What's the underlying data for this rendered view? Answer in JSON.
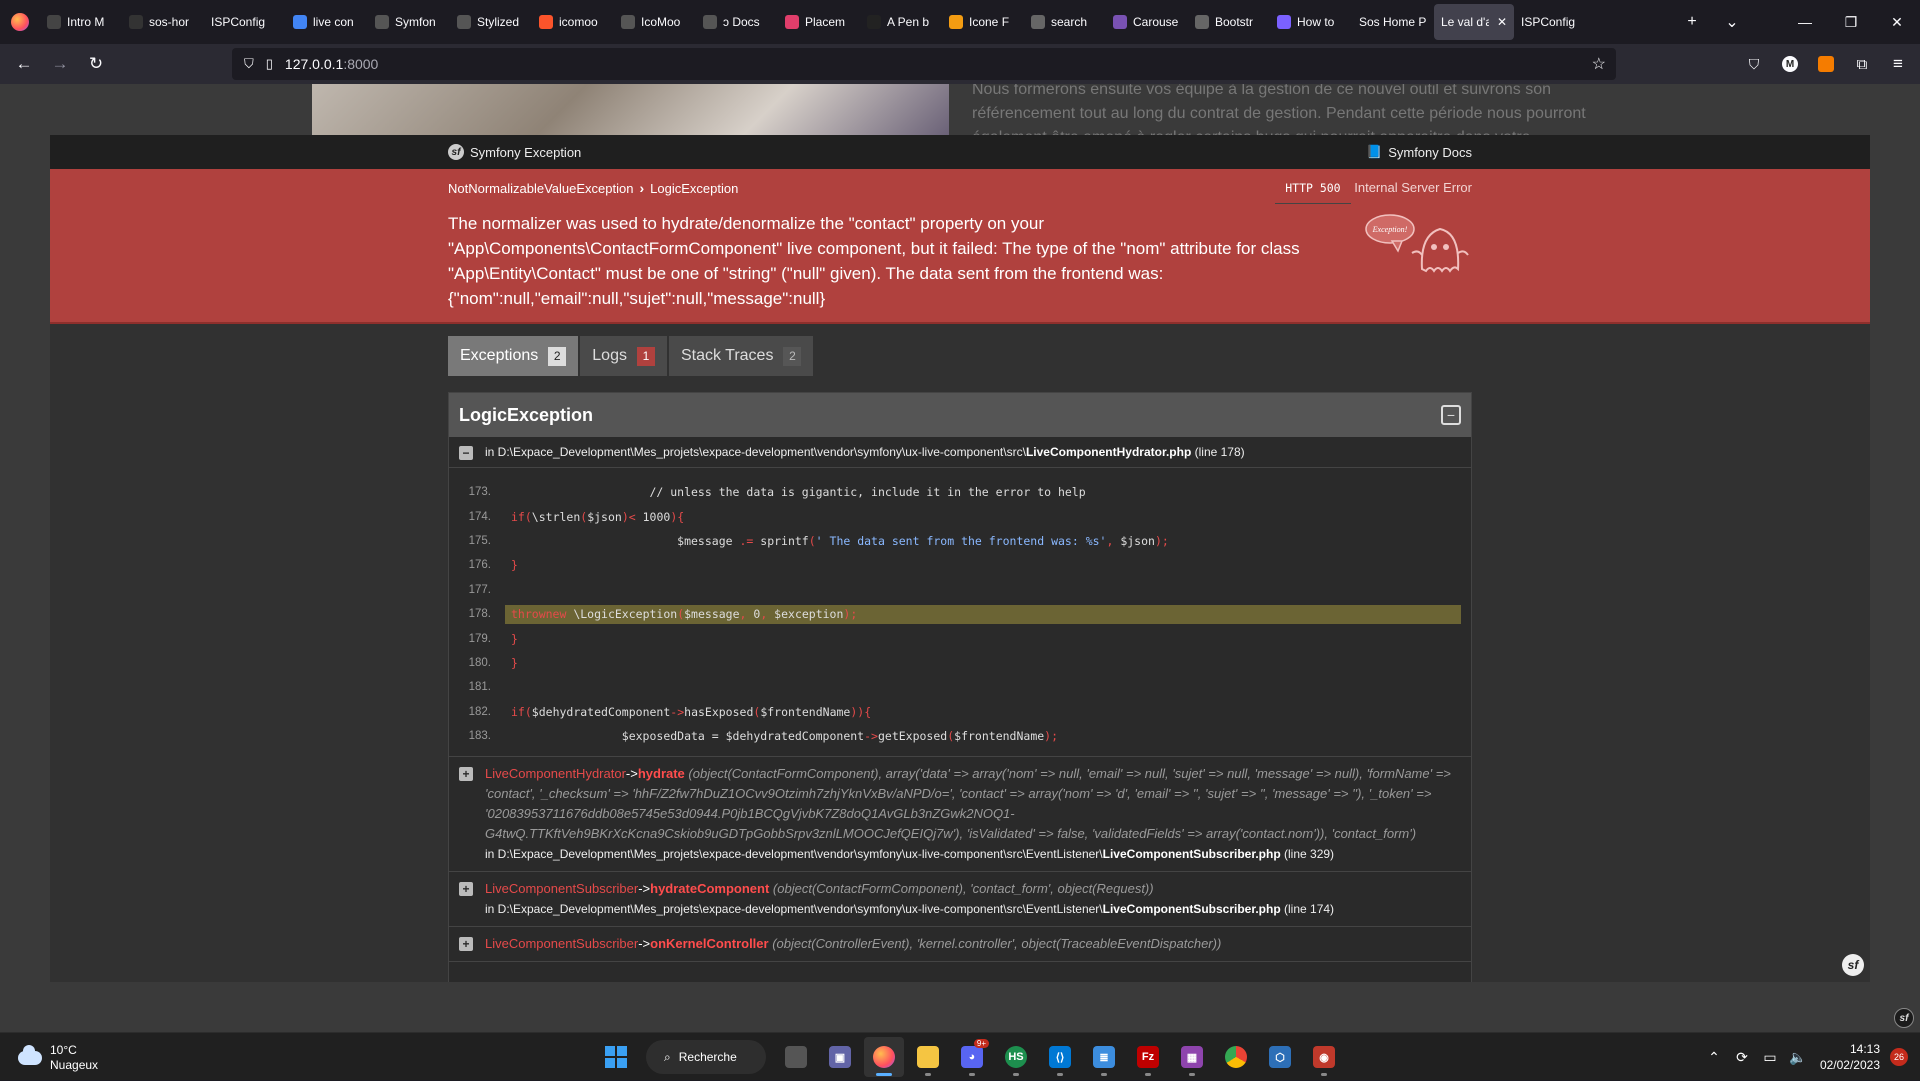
{
  "browser": {
    "tabs": [
      {
        "label": "Intro M",
        "icon": "p-icon",
        "color": "#444"
      },
      {
        "label": "sos-hor",
        "icon": "github-icon",
        "color": "#333"
      },
      {
        "label": "ISPConfig",
        "icon": "",
        "color": ""
      },
      {
        "label": "live con",
        "icon": "google-icon",
        "color": "#4285f4"
      },
      {
        "label": "Symfon",
        "icon": "symfony-icon",
        "color": "#555"
      },
      {
        "label": "Stylized",
        "icon": "symfony-icon",
        "color": "#555"
      },
      {
        "label": "icomoo",
        "icon": "brave-icon",
        "color": "#fb542b"
      },
      {
        "label": "IcoMoo",
        "icon": "icomoon-icon",
        "color": "#555"
      },
      {
        "label": "ↄ Docs",
        "icon": "icomoon-icon",
        "color": "#555"
      },
      {
        "label": "Placem",
        "icon": "arrow-icon",
        "color": "#e03e6b"
      },
      {
        "label": "A Pen b",
        "icon": "codepen-icon",
        "color": "#222"
      },
      {
        "label": "Icone F",
        "icon": "bars-icon",
        "color": "#f39c12"
      },
      {
        "label": "search",
        "icon": "face-icon",
        "color": "#666"
      },
      {
        "label": "Carouse",
        "icon": "bootstrap-icon",
        "color": "#7952b3"
      },
      {
        "label": "Bootstr",
        "icon": "doc-icon",
        "color": "#666"
      },
      {
        "label": "How to",
        "icon": "ai-icon",
        "color": "#7b61ff"
      },
      {
        "label": "Sos Home P",
        "icon": "",
        "color": ""
      },
      {
        "label": "Le val d'a",
        "icon": "",
        "color": "",
        "active": true
      },
      {
        "label": "ISPConfig",
        "icon": "",
        "color": ""
      }
    ],
    "url_host": "127.0.0.1",
    "url_port": ":8000"
  },
  "background": {
    "text": "Nous formerons ensuite vos équipe à la gestion de ce nouvel outil et suivrons son référencement tout au long du contrat de gestion. Pendant cette période nous pourront également être amené à regler certains bugs qui pourrait apparaitre dans votre"
  },
  "symfony": {
    "header_brand": "Symfony Exception",
    "header_docs": "Symfony Docs",
    "crumb_1": "NotNormalizableValueException",
    "crumb_2": "LogicException",
    "status_code": "HTTP 500",
    "status_text": "Internal Server Error",
    "message": "The normalizer was used to hydrate/denormalize the \"contact\" property on your \"App\\Components\\ContactFormComponent\" live component, but it failed: The type of the \"nom\" attribute for class \"App\\Entity\\Contact\" must be one of \"string\" (\"null\" given). The data sent from the frontend was: {\"nom\":null,\"email\":null,\"sujet\":null,\"message\":null}",
    "ghost_label": "Exception!",
    "tabs": [
      {
        "label": "Exceptions",
        "count": "2"
      },
      {
        "label": "Logs",
        "count": "1"
      },
      {
        "label": "Stack Traces",
        "count": "2"
      }
    ],
    "exception_title": "LogicException",
    "trace_prefix": "in D:\\Expace_Development\\Mes_projets\\expace-development\\vendor\\symfony\\ux-live-component\\src\\",
    "trace_file": "LiveComponentHydrator.php",
    "trace_line": "(line 178)",
    "code": [
      {
        "ln": "173.",
        "text": "                    // unless the data is gigantic, include it in the error to help"
      },
      {
        "ln": "174.",
        "text": "                    if (\\strlen($json) < 1000) {"
      },
      {
        "ln": "175.",
        "text": "                        $message .= sprintf(' The data sent from the frontend was: %s', $json);"
      },
      {
        "ln": "176.",
        "text": "                    }"
      },
      {
        "ln": "177.",
        "text": ""
      },
      {
        "ln": "178.",
        "text": "                    throw new \\LogicException($message, 0, $exception);"
      },
      {
        "ln": "179.",
        "text": "                }"
      },
      {
        "ln": "180.",
        "text": "            }"
      },
      {
        "ln": "181.",
        "text": ""
      },
      {
        "ln": "182.",
        "text": "            if ($dehydratedComponent->hasExposed($frontendName)) {"
      },
      {
        "ln": "183.",
        "text": "                $exposedData = $dehydratedComponent->getExposed($frontendName);"
      }
    ],
    "frames": [
      {
        "cls": "LiveComponentHydrator",
        "method": "hydrate",
        "args": "(object(ContactFormComponent), array('data' => array('nom' => null, 'email' => null, 'sujet' => null, 'message' => null), 'formName' => 'contact', '_checksum' => 'hhF/Z2fw7hDuZ1OCvv9Otzimh7zhjYknVxBv/aNPD/o=', 'contact' => array('nom' => 'd', 'email' => '', 'sujet' => '', 'message' => ''), '_token' => '02083953711676ddb08e5745e53d0944.P0jb1BCQgVjvbK7Z8doQ1AvGLb3nZGwk2NOQ1-G4twQ.TTKftVeh9BKrXcKcna9Cskiob9uGDTpGobbSrpv3znlLMOOCJefQEIQj7w'), 'isValidated' => false, 'validatedFields' => array('contact.nom')), 'contact_form')",
        "file_prefix": "in D:\\Expace_Development\\Mes_projets\\expace-development\\vendor\\symfony\\ux-live-component\\src\\EventListener\\",
        "file": "LiveComponentSubscriber.php",
        "line": "(line 329)"
      },
      {
        "cls": "LiveComponentSubscriber",
        "method": "hydrateComponent",
        "args": "(object(ContactFormComponent), 'contact_form', object(Request))",
        "file_prefix": "in D:\\Expace_Development\\Mes_projets\\expace-development\\vendor\\symfony\\ux-live-component\\src\\EventListener\\",
        "file": "LiveComponentSubscriber.php",
        "line": "(line 174)"
      },
      {
        "cls": "LiveComponentSubscriber",
        "method": "onKernelController",
        "args": "(object(ControllerEvent), 'kernel.controller', object(TraceableEventDispatcher))",
        "file_prefix": "",
        "file": "",
        "line": ""
      }
    ]
  },
  "taskbar": {
    "temperature": "10°C",
    "weather": "Nuageux",
    "search_label": "Recherche",
    "chat_badge": "9+",
    "time": "14:13",
    "date": "02/02/2023",
    "notifications": "26"
  }
}
